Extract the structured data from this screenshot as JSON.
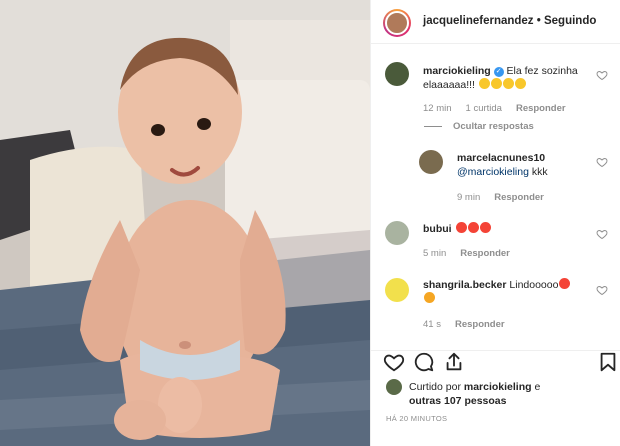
{
  "post": {
    "username": "jacquelinefernandez",
    "separator": " • ",
    "follow_label": "Seguindo"
  },
  "comments": [
    {
      "user": "marciokieling",
      "verified": true,
      "text_line1": "Ela fez sozinha",
      "text_line2": "elaaaaaa!!!",
      "time": "12 min",
      "likes": "1 curtida",
      "reply": "Responder",
      "avatar_color": "#4a5a3a"
    },
    {
      "user": "marcelacnunes10",
      "mention": "@marciokieling",
      "text": " kkk",
      "time": "9 min",
      "reply": "Responder",
      "avatar_color": "#7a6b4f"
    },
    {
      "user": "bubui",
      "text": "",
      "time": "5 min",
      "reply": "Responder",
      "avatar_color": "#a9b3a0"
    },
    {
      "user": "shangrila.becker",
      "text": "Lindooooo",
      "time": "41 s",
      "reply": "Responder",
      "avatar_color": "#f2e04c"
    }
  ],
  "hide_replies": "Ocultar respostas",
  "likes_summary": {
    "prefix": "Curtido por ",
    "user": "marciokieling",
    "suffix": " e",
    "others": "outras 107 pessoas"
  },
  "timestamp": "HÁ 20 MINUTOS",
  "icons": [
    "heart-icon",
    "comment-icon",
    "share-icon",
    "bookmark-icon"
  ],
  "colors": {
    "link": "#003569",
    "muted": "#8e8e8e",
    "verified": "#3897f0"
  }
}
